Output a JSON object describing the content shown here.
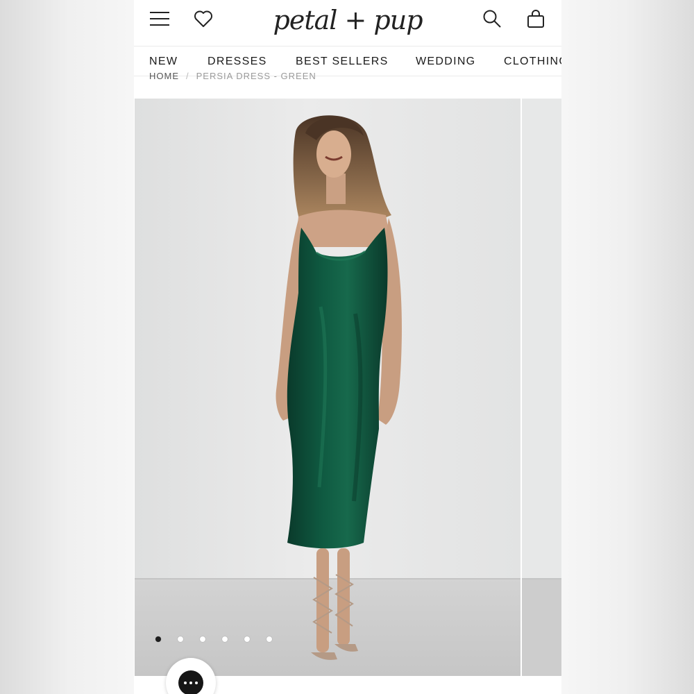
{
  "header": {
    "logo_text": "petal + pup",
    "icons": [
      "menu-icon",
      "heart-icon",
      "search-icon",
      "shopping-bag-icon"
    ]
  },
  "nav": {
    "items": [
      {
        "label": "NEW"
      },
      {
        "label": "DRESSES"
      },
      {
        "label": "BEST SELLERS"
      },
      {
        "label": "WEDDING"
      },
      {
        "label": "CLOTHING"
      }
    ]
  },
  "breadcrumb": {
    "home": "HOME",
    "separator": "/",
    "current": "PERSIA DRESS - GREEN"
  },
  "gallery": {
    "slide_count": 6,
    "active_index": 0,
    "dress_color": "#0f4f3a"
  },
  "chat": {
    "icon": "chat-dots-icon"
  }
}
